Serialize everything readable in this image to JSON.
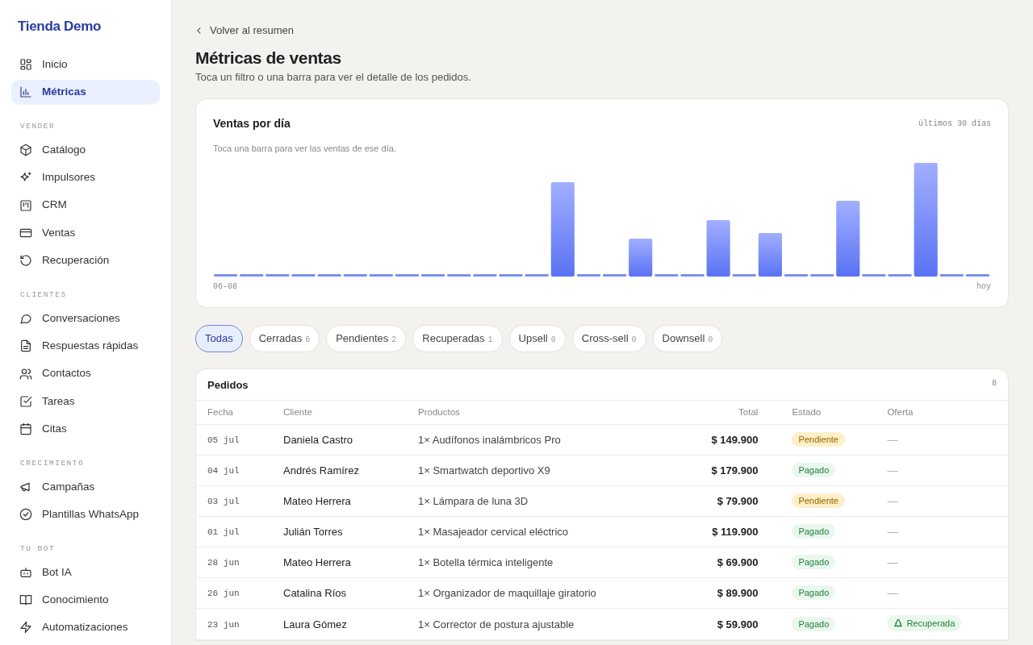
{
  "brand": "Tienda Demo",
  "sidebar": {
    "sections": [
      {
        "items": [
          {
            "label": "Inicio",
            "selected": false
          },
          {
            "label": "Métricas",
            "selected": true
          }
        ]
      },
      {
        "heading": "VENDER",
        "items": [
          {
            "label": "Catálogo",
            "selected": false
          },
          {
            "label": "Impulsores",
            "selected": false
          },
          {
            "label": "CRM",
            "selected": false
          },
          {
            "label": "Ventas",
            "selected": false
          },
          {
            "label": "Recuperación",
            "selected": false
          }
        ]
      },
      {
        "heading": "CLIENTES",
        "items": [
          {
            "label": "Conversaciones",
            "selected": false
          },
          {
            "label": "Respuestas rápidas",
            "selected": false
          },
          {
            "label": "Contactos",
            "selected": false
          },
          {
            "label": "Tareas",
            "selected": false
          },
          {
            "label": "Citas",
            "selected": false
          }
        ]
      },
      {
        "heading": "CRECIMIENTO",
        "items": [
          {
            "label": "Campañas",
            "selected": false
          },
          {
            "label": "Plantillas WhatsApp",
            "selected": false
          }
        ]
      },
      {
        "heading": "TU BOT",
        "items": [
          {
            "label": "Bot IA",
            "selected": false
          },
          {
            "label": "Conocimiento",
            "selected": false
          },
          {
            "label": "Automatizaciones",
            "selected": false
          }
        ]
      }
    ]
  },
  "back_link": "Volver al resumen",
  "title": "Métricas de ventas",
  "subtitle": "Toca un filtro o una barra para ver el detalle de los pedidos.",
  "chart_card": {
    "title": "Ventas por día",
    "range": "últimos 30 días",
    "hint": "Toca una barra para ver las ventas de ese día.",
    "start_label": "06-08",
    "end_label": "hoy"
  },
  "filters": [
    {
      "label": "Todas",
      "selected": true
    },
    {
      "label": "Cerradas",
      "count": "6",
      "selected": false
    },
    {
      "label": "Pendientes",
      "count": "2",
      "selected": false
    },
    {
      "label": "Recuperadas",
      "count": "1",
      "selected": false
    },
    {
      "label": "Upsell",
      "count": "0",
      "selected": false
    },
    {
      "label": "Cross-sell",
      "count": "0",
      "selected": false
    },
    {
      "label": "Downsell",
      "count": "0",
      "selected": false
    }
  ],
  "orders": {
    "title": "Pedidos",
    "count": "8",
    "columns": [
      "Fecha",
      "Cliente",
      "Productos",
      "Total",
      "Estado",
      "Oferta"
    ],
    "rows": [
      {
        "date": "05 jul",
        "client": "Daniela Castro",
        "products": "1× Audífonos inalámbricos Pro",
        "total": "$ 149.900",
        "status": {
          "text": "Pendiente",
          "kind": "pending"
        },
        "offer": {
          "text": "—",
          "kind": "none"
        }
      },
      {
        "date": "04 jul",
        "client": "Andrés Ramírez",
        "products": "1× Smartwatch deportivo X9",
        "total": "$ 179.900",
        "status": {
          "text": "Pagado",
          "kind": "paid"
        },
        "offer": {
          "text": "—",
          "kind": "none"
        }
      },
      {
        "date": "03 jul",
        "client": "Mateo Herrera",
        "products": "1× Lámpara de luna 3D",
        "total": "$ 79.900",
        "status": {
          "text": "Pendiente",
          "kind": "pending"
        },
        "offer": {
          "text": "—",
          "kind": "none"
        }
      },
      {
        "date": "01 jul",
        "client": "Julián Torres",
        "products": "1× Masajeador cervical eléctrico",
        "total": "$ 119.900",
        "status": {
          "text": "Pagado",
          "kind": "paid"
        },
        "offer": {
          "text": "—",
          "kind": "none"
        }
      },
      {
        "date": "28 jun",
        "client": "Mateo Herrera",
        "products": "1× Botella térmica inteligente",
        "total": "$ 69.900",
        "status": {
          "text": "Pagado",
          "kind": "paid"
        },
        "offer": {
          "text": "—",
          "kind": "none"
        }
      },
      {
        "date": "26 jun",
        "client": "Catalina Ríos",
        "products": "1× Organizador de maquillaje giratorio",
        "total": "$ 89.900",
        "status": {
          "text": "Pagado",
          "kind": "paid"
        },
        "offer": {
          "text": "—",
          "kind": "none"
        }
      },
      {
        "date": "23 jun",
        "client": "Laura Gómez",
        "products": "1× Corrector de postura ajustable",
        "total": "$ 59.900",
        "status": {
          "text": "Pagado",
          "kind": "paid"
        },
        "offer": {
          "text": "Recuperada",
          "kind": "recovered"
        }
      }
    ]
  }
}
